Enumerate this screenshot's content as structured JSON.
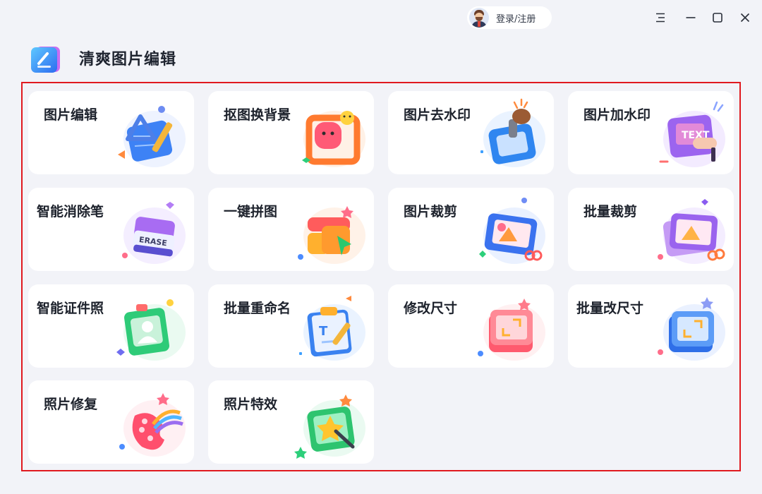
{
  "header": {
    "login_label": "登录/注册",
    "app_title": "清爽图片编辑",
    "window_controls": [
      "menu-icon",
      "minimize-icon",
      "maximize-icon",
      "close-icon"
    ]
  },
  "colors": {
    "background": "#f2f3f8",
    "card": "#ffffff",
    "frame_highlight": "#e0191f"
  },
  "tools": [
    {
      "label": "图片编辑",
      "icon": "image-edit-icon"
    },
    {
      "label": "抠图换背景",
      "icon": "cutout-background-icon"
    },
    {
      "label": "图片去水印",
      "icon": "remove-watermark-icon"
    },
    {
      "label": "图片加水印",
      "icon": "add-watermark-icon"
    },
    {
      "label": "智能消除笔",
      "icon": "eraser-icon"
    },
    {
      "label": "一键拼图",
      "icon": "collage-icon"
    },
    {
      "label": "图片裁剪",
      "icon": "crop-image-icon"
    },
    {
      "label": "批量裁剪",
      "icon": "batch-crop-icon"
    },
    {
      "label": "智能证件照",
      "icon": "id-photo-icon"
    },
    {
      "label": "批量重命名",
      "icon": "batch-rename-icon"
    },
    {
      "label": "修改尺寸",
      "icon": "resize-icon"
    },
    {
      "label": "批量改尺寸",
      "icon": "batch-resize-icon"
    },
    {
      "label": "照片修复",
      "icon": "photo-restore-icon"
    },
    {
      "label": "照片特效",
      "icon": "photo-effects-icon"
    }
  ]
}
